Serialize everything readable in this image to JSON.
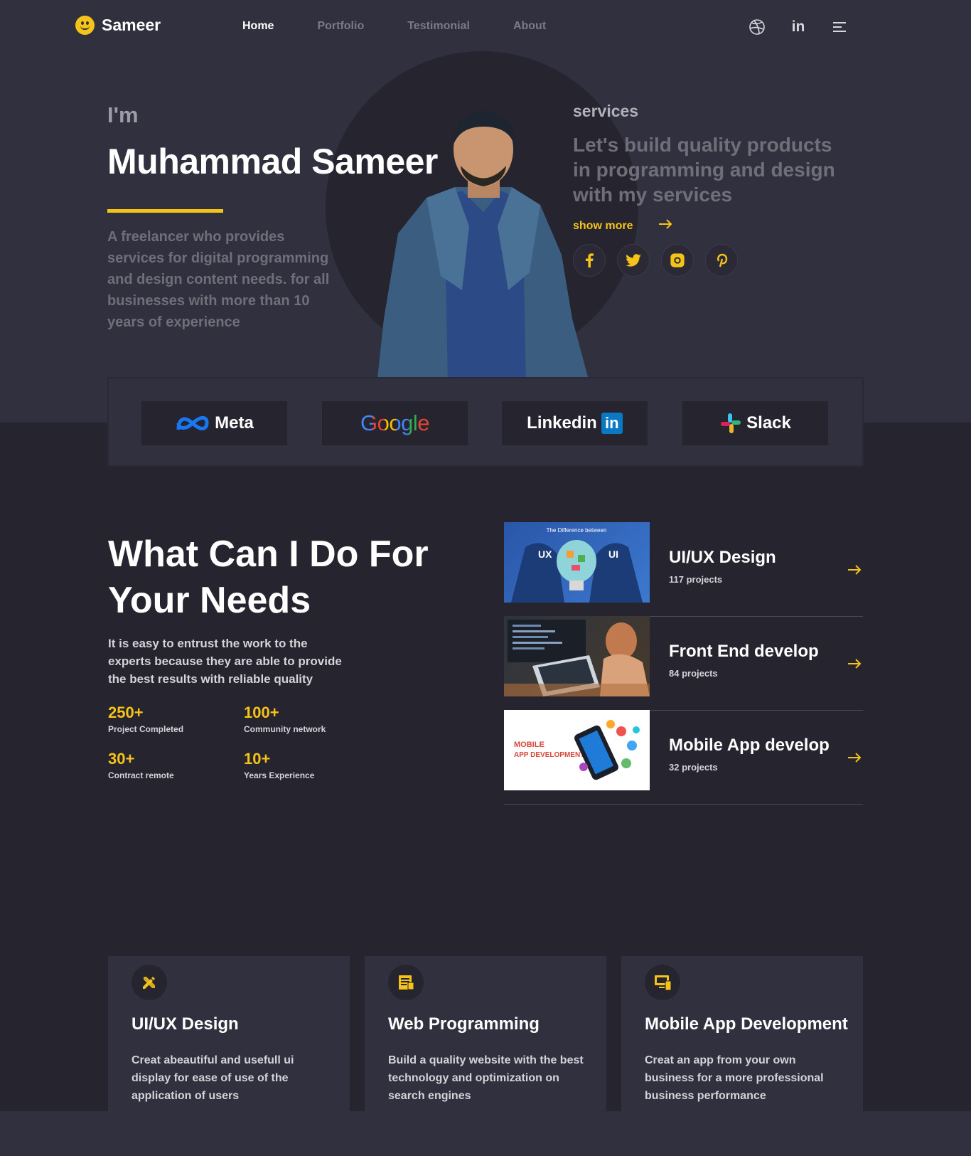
{
  "nav": {
    "logo_text": "Sameer",
    "items": [
      {
        "label": "Home",
        "active": true
      },
      {
        "label": "Portfolio",
        "active": false
      },
      {
        "label": "Testimonial",
        "active": false
      },
      {
        "label": "About",
        "active": false
      }
    ],
    "icons": [
      "dribbble-icon",
      "linkedin-icon",
      "menu-icon"
    ],
    "linkedin_text": "in"
  },
  "hero": {
    "greeting": "I'm",
    "name": "Muhammad Sameer",
    "intro": "A freelancer who provides services for digital programming and design content needs. for all businesses with more than 10 years of experience",
    "services_label": "services",
    "services_tagline": "Let's build quality products in programming and design with my services",
    "show_more": "show more",
    "socials": [
      "facebook-icon",
      "twitter-icon",
      "instagram-icon",
      "pinterest-icon"
    ]
  },
  "brands": [
    {
      "name": "Meta"
    },
    {
      "name": "Google"
    },
    {
      "name": "Linkedin",
      "badge": "in"
    },
    {
      "name": "Slack"
    }
  ],
  "what_can_i_do": {
    "title": "What Can I Do For Your Needs",
    "description": "It is easy to entrust the work to the experts because they are able to provide the best results with reliable quality",
    "stats": [
      {
        "value": "250+",
        "label": "Project Completed"
      },
      {
        "value": "100+",
        "label": "Community network"
      },
      {
        "value": "30+",
        "label": "Contract remote"
      },
      {
        "value": "10+",
        "label": "Years Experience"
      }
    ],
    "services": [
      {
        "title": "UI/UX Design",
        "projects": "117 projects",
        "image_text": "The Difference between",
        "image_left": "UX",
        "image_right": "UI"
      },
      {
        "title": "Front End develop",
        "projects": "84 projects"
      },
      {
        "title": "Mobile App develop",
        "projects": "32 projects",
        "image_text_1": "MOBILE",
        "image_text_2": "APP DEVELOPMENT"
      }
    ]
  },
  "cards": [
    {
      "icon": "design-tools-icon",
      "title": "UI/UX Design",
      "description": "Creat abeautiful and usefull ui display for ease of use of the application of users"
    },
    {
      "icon": "web-code-icon",
      "title": "Web Programming",
      "description": "Build a quality website with the best technology and optimization on search engines"
    },
    {
      "icon": "mobile-devices-icon",
      "title": "Mobile App Development",
      "description": "Creat an app from your own business for a more professional business performance"
    }
  ],
  "colors": {
    "accent": "#f6c419",
    "bg_dark": "#25242f",
    "bg_panel": "#31303e"
  }
}
